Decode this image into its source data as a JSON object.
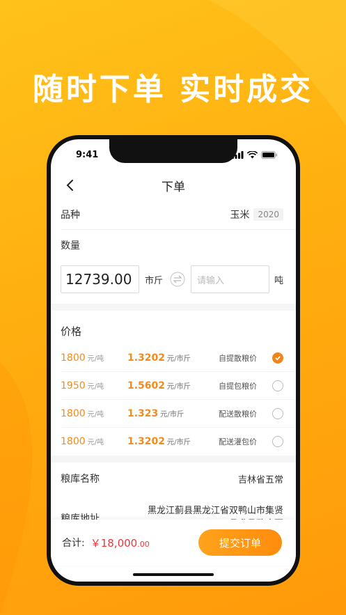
{
  "headline": "随时下单 实时成交",
  "status": {
    "time": "9:41"
  },
  "nav": {
    "title": "下单"
  },
  "variety": {
    "label": "品种",
    "value": "玉米",
    "year": "2020"
  },
  "quantity": {
    "label": "数量",
    "value": "12739.00",
    "unit_primary": "市斤",
    "placeholder": "请输入",
    "unit_secondary": "吨"
  },
  "price": {
    "title": "价格",
    "rows": [
      {
        "price_ton": "1800",
        "unit_ton": "元/吨",
        "price_jin": "1.3202",
        "unit_jin": "元/市斤",
        "type": "自提散粮价",
        "selected": true
      },
      {
        "price_ton": "1950",
        "unit_ton": "元/吨",
        "price_jin": "1.5602",
        "unit_jin": "元/市斤",
        "type": "自提包粮价",
        "selected": false
      },
      {
        "price_ton": "1800",
        "unit_ton": "元/吨",
        "price_jin": "1.323",
        "unit_jin": "元/市斤",
        "type": "配送散粮价",
        "selected": false
      },
      {
        "price_ton": "1800",
        "unit_ton": "元/吨",
        "price_jin": "1.3202",
        "unit_jin": "元/市斤",
        "type": "配送灌包价",
        "selected": false
      }
    ]
  },
  "granary": {
    "name_label": "粮库名称",
    "name_value": "吉林省五常",
    "addr_label": "粮库地址",
    "addr_value": "黑龙江蓟县黑龙江省双鸭山市集贤县升县政府西"
  },
  "footer": {
    "total_label": "合计:",
    "total_main": "￥18,000",
    "total_decimal": ".00",
    "submit_label": "提交订单"
  },
  "colors": {
    "accent": "#f2851a",
    "price": "#f08c1e",
    "total": "#e8373a"
  }
}
